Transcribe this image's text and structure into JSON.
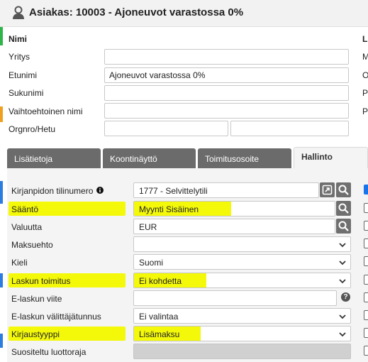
{
  "header": {
    "title": "Asiakas: 10003 - Ajoneuvot varastossa 0%"
  },
  "name_section": {
    "title": "Nimi",
    "fields": [
      {
        "label": "Yritys",
        "value": ""
      },
      {
        "label": "Etunimi",
        "value": "Ajoneuvot varastossa 0%"
      },
      {
        "label": "Sukunimi",
        "value": ""
      },
      {
        "label": "Vaihtoehtoinen nimi",
        "value": ""
      },
      {
        "label": "Orgnro/Hetu",
        "value": "",
        "value2": ""
      }
    ]
  },
  "right_column": {
    "heading": "L",
    "items": [
      "M",
      "O",
      "P",
      "P"
    ]
  },
  "tabs": [
    {
      "label": "Lisätietoja",
      "active": false
    },
    {
      "label": "Koontinäyttö",
      "active": false
    },
    {
      "label": "Toimitusosoite",
      "active": false
    },
    {
      "label": "Hallinto",
      "active": true
    }
  ],
  "admin": {
    "rows": [
      {
        "label": "Kirjanpidon tilinumero",
        "value": "1777 - Selvittelytili",
        "info": true,
        "buttons": [
          "open-link-icon",
          "search-icon"
        ],
        "highlight": false,
        "checkbox_checked": true
      },
      {
        "label": "Sääntö",
        "value": "Myynti Sisäinen",
        "buttons": [
          "search-icon"
        ],
        "highlight": true
      },
      {
        "label": "Valuutta",
        "value": "EUR",
        "buttons": [
          "search-icon"
        ],
        "highlight": false
      },
      {
        "label": "Maksuehto",
        "value": "",
        "dropdown": true,
        "highlight": false
      },
      {
        "label": "Kieli",
        "value": "Suomi",
        "dropdown": true,
        "highlight": false
      },
      {
        "label": "Laskun toimitus",
        "value": "Ei kohdetta",
        "dropdown": true,
        "highlight": true
      },
      {
        "label": "E-laskun viite",
        "value": "",
        "help": "?",
        "highlight": false
      },
      {
        "label": "E-laskun välittäjätunnus",
        "value": "Ei valintaa",
        "dropdown": true,
        "highlight": false
      },
      {
        "label": "Kirjaustyyppi",
        "value": "Lisämaksu",
        "dropdown": true,
        "highlight": true
      },
      {
        "label": "Suositeltu luottoraja",
        "value": "",
        "disabled": true,
        "highlight": false
      }
    ]
  },
  "colors": {
    "highlight": "#f4f90a",
    "tab_inactive": "#6b6b6b",
    "panel_bg": "#f4f4f4",
    "checkbox_checked": "#1a73e8"
  }
}
